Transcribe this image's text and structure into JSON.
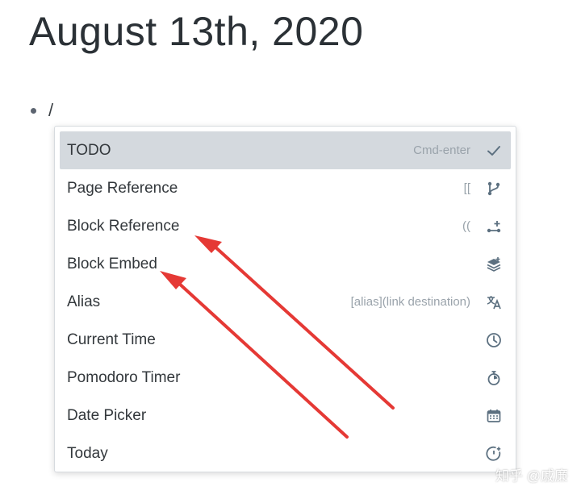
{
  "page": {
    "title": "August 13th, 2020"
  },
  "block": {
    "text": "/"
  },
  "menu": {
    "items": [
      {
        "label": "TODO",
        "shortcut": "Cmd-enter",
        "icon": "checkmark-icon",
        "active": true
      },
      {
        "label": "Page Reference",
        "shortcut": "[[",
        "icon": "git-branch-icon",
        "active": false
      },
      {
        "label": "Block Reference",
        "shortcut": "((",
        "icon": "git-new-branch-icon",
        "active": false
      },
      {
        "label": "Block Embed",
        "shortcut": "",
        "icon": "layers-icon",
        "active": false
      },
      {
        "label": "Alias",
        "shortcut": "[alias](link destination)",
        "icon": "translate-icon",
        "active": false
      },
      {
        "label": "Current Time",
        "shortcut": "",
        "icon": "clock-icon",
        "active": false
      },
      {
        "label": "Pomodoro Timer",
        "shortcut": "",
        "icon": "stopwatch-icon",
        "active": false
      },
      {
        "label": "Date Picker",
        "shortcut": "",
        "icon": "calendar-icon",
        "active": false
      },
      {
        "label": "Today",
        "shortcut": "",
        "icon": "time-icon",
        "active": false
      }
    ]
  },
  "watermark": {
    "text": "知乎 @戚廉"
  },
  "colors": {
    "highlight": "#d4d9de",
    "arrow": "#e53935",
    "icon": "#5c7080"
  }
}
